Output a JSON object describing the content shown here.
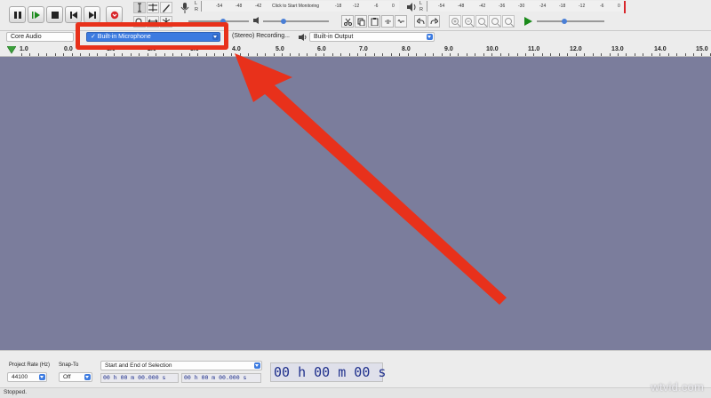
{
  "toolbar": {
    "play_meter_ticks": [
      "-54",
      "-48",
      "-42",
      "-18",
      "-12",
      "-6",
      "0"
    ],
    "rec_meter_hint": "Click to Start Monitoring",
    "out_meter_ticks": [
      "-54",
      "-48",
      "-42",
      "-36",
      "-30",
      "-24",
      "-18",
      "-12",
      "-6",
      "0"
    ],
    "meter_channel_left": "L",
    "meter_channel_right": "R"
  },
  "devices": {
    "host": "Core Audio",
    "recording_device": "✓ Built-in Microphone",
    "channels": "(Stereo) Recording...",
    "playback_device": "Built-in Output"
  },
  "ruler": {
    "labels": [
      "1.0",
      "0.0",
      "1.0",
      "2.0",
      "3.0",
      "4.0",
      "5.0",
      "6.0",
      "7.0",
      "8.0",
      "9.0",
      "10.0",
      "11.0",
      "12.0",
      "13.0",
      "14.0",
      "15.0"
    ]
  },
  "selection_toolbar": {
    "project_rate_label": "Project Rate (Hz)",
    "project_rate_value": "44100",
    "snap_to_label": "Snap-To",
    "snap_to_value": "Off",
    "selection_mode": "Start and End of Selection",
    "selection_start": "00 h 00 m 00.000 s",
    "selection_end": "00 h 00 m 00.000 s",
    "audio_position": "00 h 00 m 00 s"
  },
  "status": {
    "text": "Stopped."
  },
  "annotation": {
    "arrow_color": "#e8311b",
    "box_color": "#e8311b"
  },
  "watermark": "wtvid.com",
  "colors": {
    "track_background": "#7b7d9c",
    "accent": "#3d7be0",
    "time_text": "#1e2f8c"
  }
}
